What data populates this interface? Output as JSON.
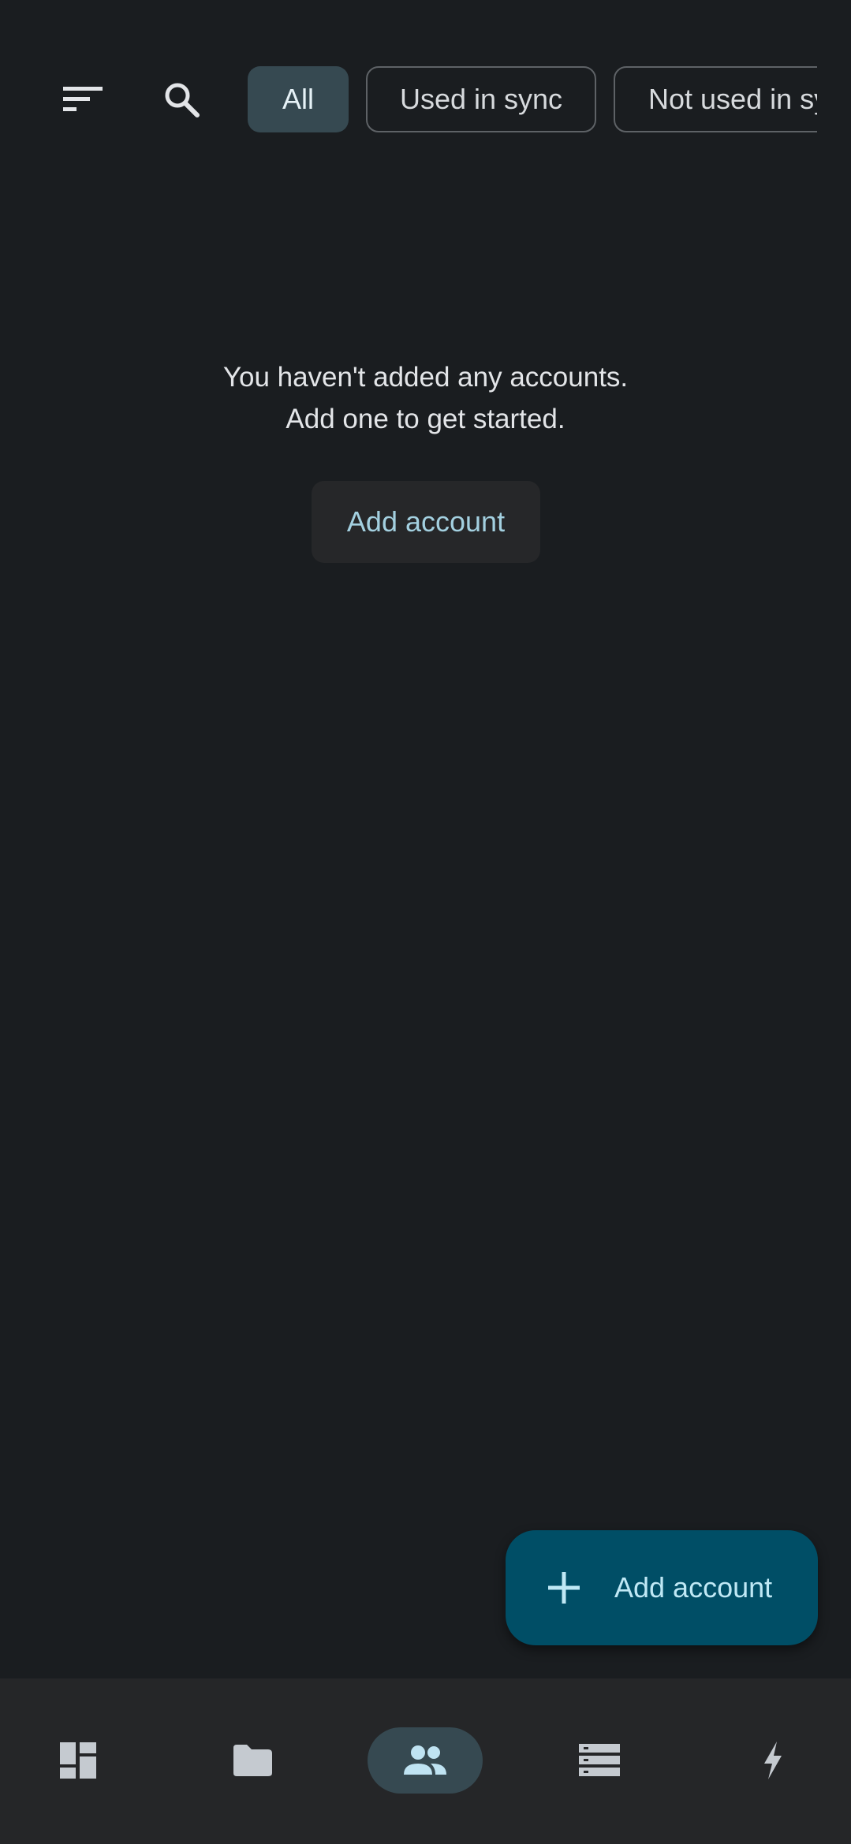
{
  "filters": {
    "chips": [
      {
        "label": "All",
        "selected": true
      },
      {
        "label": "Used in sync",
        "selected": false
      },
      {
        "label": "Not used in sync",
        "selected": false
      }
    ],
    "sort_icon": "sort-icon",
    "search_icon": "search-icon"
  },
  "empty_state": {
    "line1": "You haven't added any accounts.",
    "line2": "Add one to get started.",
    "button_label": "Add account"
  },
  "fab": {
    "label": "Add account",
    "icon": "plus-icon"
  },
  "bottom_nav": {
    "items": [
      {
        "icon": "dashboard-icon",
        "active": false
      },
      {
        "icon": "folder-icon",
        "active": false
      },
      {
        "icon": "accounts-icon",
        "active": true
      },
      {
        "icon": "list-icon",
        "active": false
      },
      {
        "icon": "bolt-icon",
        "active": false
      }
    ]
  },
  "colors": {
    "background": "#1a1d20",
    "chip_selected": "#364951",
    "fab": "#004e66",
    "accent_text": "#a3d0e0",
    "nav_background": "#252628"
  }
}
